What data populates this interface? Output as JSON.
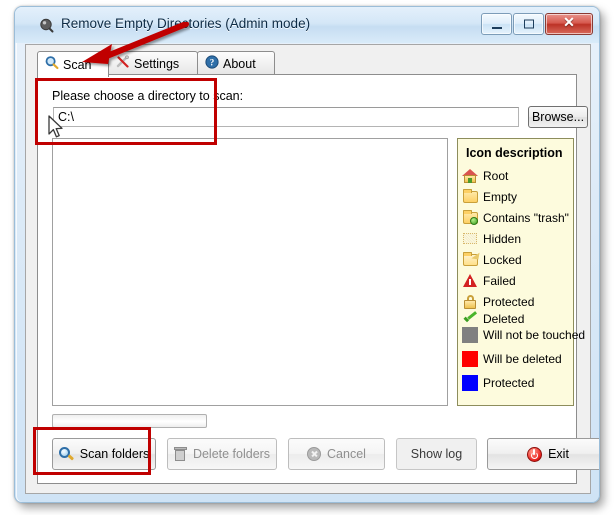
{
  "window": {
    "title": "Remove Empty Directories (Admin mode)",
    "app_icon": "magnifier-app-icon",
    "controls": {
      "minimize": "minimize-icon",
      "maximize": "maximize-icon",
      "close": "✕"
    }
  },
  "tabs": [
    {
      "label": "Scan",
      "icon": "magnifier-icon",
      "active": true
    },
    {
      "label": "Settings",
      "icon": "tools-icon",
      "active": false
    },
    {
      "label": "About",
      "icon": "question-mark-icon",
      "active": false
    }
  ],
  "scan_panel": {
    "group_label": "Please choose a directory to scan:",
    "path_value": "C:\\",
    "path_placeholder": "",
    "browse_label": "Browse...",
    "progress_percent": 0
  },
  "legend": {
    "title": "Icon description",
    "rows": [
      {
        "label": "Root",
        "icon": "house-icon",
        "color": "#d9534f"
      },
      {
        "label": "Empty",
        "icon": "folder-icon",
        "color": "#fdd065"
      },
      {
        "label": "Contains \"trash\"",
        "icon": "folder-plus-icon",
        "color": "#fdd065"
      },
      {
        "label": "Hidden",
        "icon": "folder-hidden-icon",
        "color": "#d8b86a"
      },
      {
        "label": "Locked",
        "icon": "folder-locked-icon",
        "color": "#ffe08a"
      },
      {
        "label": "Failed",
        "icon": "warning-triangle-icon",
        "color": "#d32222"
      },
      {
        "label": "Protected",
        "icon": "padlock-icon",
        "color": "#eec34f"
      },
      {
        "label": "Deleted",
        "icon": "green-check-icon",
        "color": "#3a9e20"
      }
    ],
    "swatches": [
      {
        "label": "Will not be touched",
        "color": "#808080"
      },
      {
        "label": "Will be deleted",
        "color": "#ff0000"
      },
      {
        "label": "Protected",
        "color": "#0000ff"
      }
    ]
  },
  "buttons": [
    {
      "label": "Scan folders",
      "icon": "magnifier-icon",
      "state": "enabled",
      "highlighted": true
    },
    {
      "label": "Delete folders",
      "icon": "trash-icon",
      "state": "disabled",
      "highlighted": false
    },
    {
      "label": "Cancel",
      "icon": "cancel-icon",
      "state": "disabled",
      "highlighted": false
    },
    {
      "label": "Show log",
      "icon": "",
      "state": "flat",
      "highlighted": false
    },
    {
      "label": "Exit",
      "icon": "power-icon",
      "state": "enabled",
      "highlighted": false
    }
  ],
  "annotations": {
    "arrow_target": "scan-tab",
    "highlight_color": "#c00000",
    "boxes": [
      "directory-group-box",
      "scan-folders-button"
    ]
  }
}
